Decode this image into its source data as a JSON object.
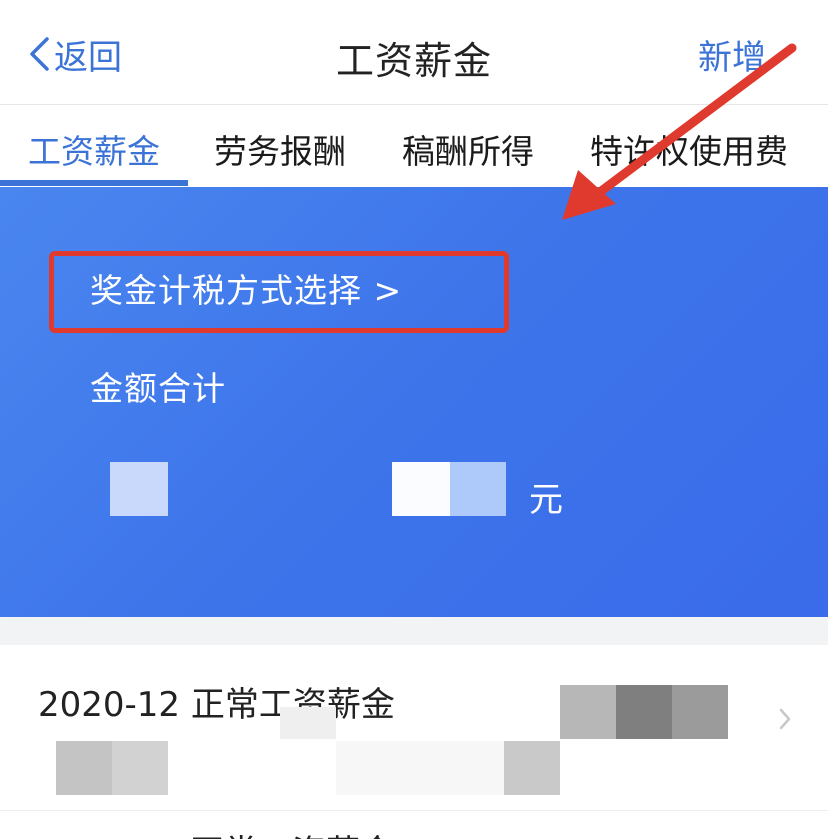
{
  "navbar": {
    "back_label": "返回",
    "title": "工资薪金",
    "add_label": "新增"
  },
  "tabs": [
    {
      "label": "工资薪金",
      "active": true
    },
    {
      "label": "劳务报酬",
      "active": false
    },
    {
      "label": "稿酬所得",
      "active": false
    },
    {
      "label": "特许权使用费",
      "active": false
    }
  ],
  "banner": {
    "bonus_tax_method_label": "奖金计税方式选择 >",
    "total_amount_label": "金额合计",
    "currency_unit": "元"
  },
  "records": [
    {
      "title": "2020-12 正常工资薪金"
    },
    {
      "title": "正常工资薪金"
    }
  ],
  "colors": {
    "accent": "#3b74d6",
    "banner": "#4a86ef",
    "annotation_red": "#e03a2f"
  }
}
